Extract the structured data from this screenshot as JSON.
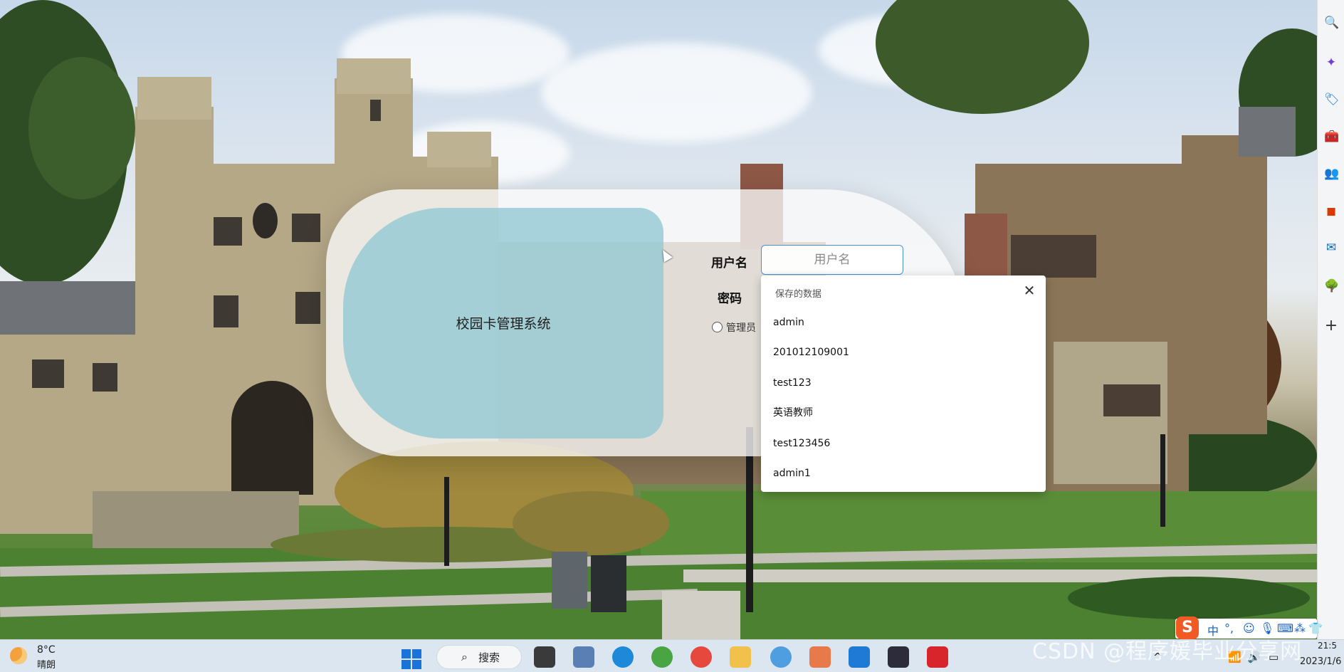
{
  "login": {
    "system_title": "校园卡管理系统",
    "username_label": "用户名",
    "username_placeholder": "用户名",
    "password_label": "密码",
    "role_option_label": "管理员"
  },
  "autofill": {
    "header": "保存的数据",
    "close_symbol": "✕",
    "items": [
      "admin",
      "201012109001",
      "test123",
      "英语教师",
      "test123456",
      "admin1"
    ]
  },
  "taskbar": {
    "weather_temp": "8°C",
    "weather_desc": "晴朗",
    "search_label": "搜索",
    "search_symbol": "⌕",
    "clock_time": "21:5",
    "clock_date": "2023/1/6"
  },
  "ime": {
    "logo": "S",
    "items": [
      "中",
      "°,",
      "☺",
      "🎙",
      "⌨",
      "⁂",
      "👕"
    ]
  },
  "tray": {
    "chevron": "^",
    "wifi": "📶",
    "volume": "🔊",
    "battery": "▭"
  },
  "sidebar": {
    "icons": [
      "🔍",
      "✦",
      "🏷",
      "🧰",
      "👥",
      "◼",
      "✉",
      "🌳",
      "+"
    ]
  },
  "watermark": "CSDN @程序媛毕业分享网",
  "colors": {
    "accent": "#4a90d9",
    "brand_panel": "#91c8d2",
    "start_blue": "#1a73d9",
    "ime_orange": "#f15a24"
  }
}
